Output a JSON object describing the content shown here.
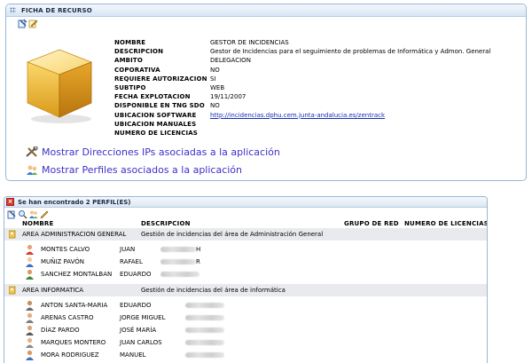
{
  "ficha": {
    "title": "FICHA DE RECURSO",
    "fields": [
      {
        "key": "NOMBRE",
        "value": "GESTOR DE INCIDENCIAS"
      },
      {
        "key": "DESCRIPCION",
        "value": "Gestor de Incidencias para el seguimiento de problemas de Informática y Admon. General"
      },
      {
        "key": "AMBITO",
        "value": "DELEGACION"
      },
      {
        "key": "COPORATIVA",
        "value": "NO"
      },
      {
        "key": "REQUIERE AUTORIZACION",
        "value": "SI"
      },
      {
        "key": "SUBTIPO",
        "value": "WEB"
      },
      {
        "key": "FECHA EXPLOTACION",
        "value": "19/11/2007"
      },
      {
        "key": "DISPONIBLE EN TNG SDO",
        "value": "NO"
      },
      {
        "key": "UBICACION SOFTWARE",
        "value": "http://incidencias.dphu.cem.junta-andalucia.es/zentrack"
      },
      {
        "key": "UBICACION MANUALES",
        "value": ""
      },
      {
        "key": "NUMERO DE LICENCIAS",
        "value": ""
      }
    ],
    "link_ips": "Mostrar Direcciones IPs asociadas a la aplicación",
    "link_perfiles": "Mostrar Perfiles asociados a la aplicación"
  },
  "perfiles": {
    "title": "Se han encontrado 2 PERFIL(ES)",
    "columns": {
      "nombre": "NOMBRE",
      "descripcion": "DESCRIPCION",
      "grupo": "GRUPO DE RED",
      "licencias": "NUMERO DE LICENCIAS"
    },
    "groups": [
      {
        "name": "AREA ADMINISTRACION GENERAL",
        "description": "Gestión de incidencias del área de Administración General",
        "members": [
          {
            "surname": "MONTES CALVO",
            "first": "JUAN",
            "id_suffix": "H"
          },
          {
            "surname": "MUÑIZ PAVÓN",
            "first": "RAFAEL",
            "id_suffix": "R"
          },
          {
            "surname": "SANCHEZ MONTALBAN",
            "first": "EDUARDO",
            "id_suffix": ""
          }
        ]
      },
      {
        "name": "AREA INFORMATICA",
        "description": "Gestión de incidencias del área de informática",
        "members": [
          {
            "surname": "ANTON SANTA-MARIA",
            "first": "EDUARDO",
            "id_suffix": ""
          },
          {
            "surname": "ARENAS CASTRO",
            "first": "JORGE MIGUEL",
            "id_suffix": ""
          },
          {
            "surname": "DÍAZ PARDO",
            "first": "JOSÉ MARÍA",
            "id_suffix": ""
          },
          {
            "surname": "MARQUES MONTERO",
            "first": "JUAN CARLOS",
            "id_suffix": ""
          },
          {
            "surname": "MORA RODRIGUEZ",
            "first": "MANUEL",
            "id_suffix": ""
          }
        ]
      }
    ]
  },
  "colors": {
    "link": "#3d2fc9",
    "panel_border": "#9bb6d6",
    "group_bg": "#e9eaed"
  },
  "icons": [
    "grip-icon",
    "edit-icon",
    "pencil-icon",
    "resource-cube-icon",
    "ip-tools-icon",
    "users-icon",
    "close-icon",
    "folder-key-icon",
    "person-icon"
  ]
}
